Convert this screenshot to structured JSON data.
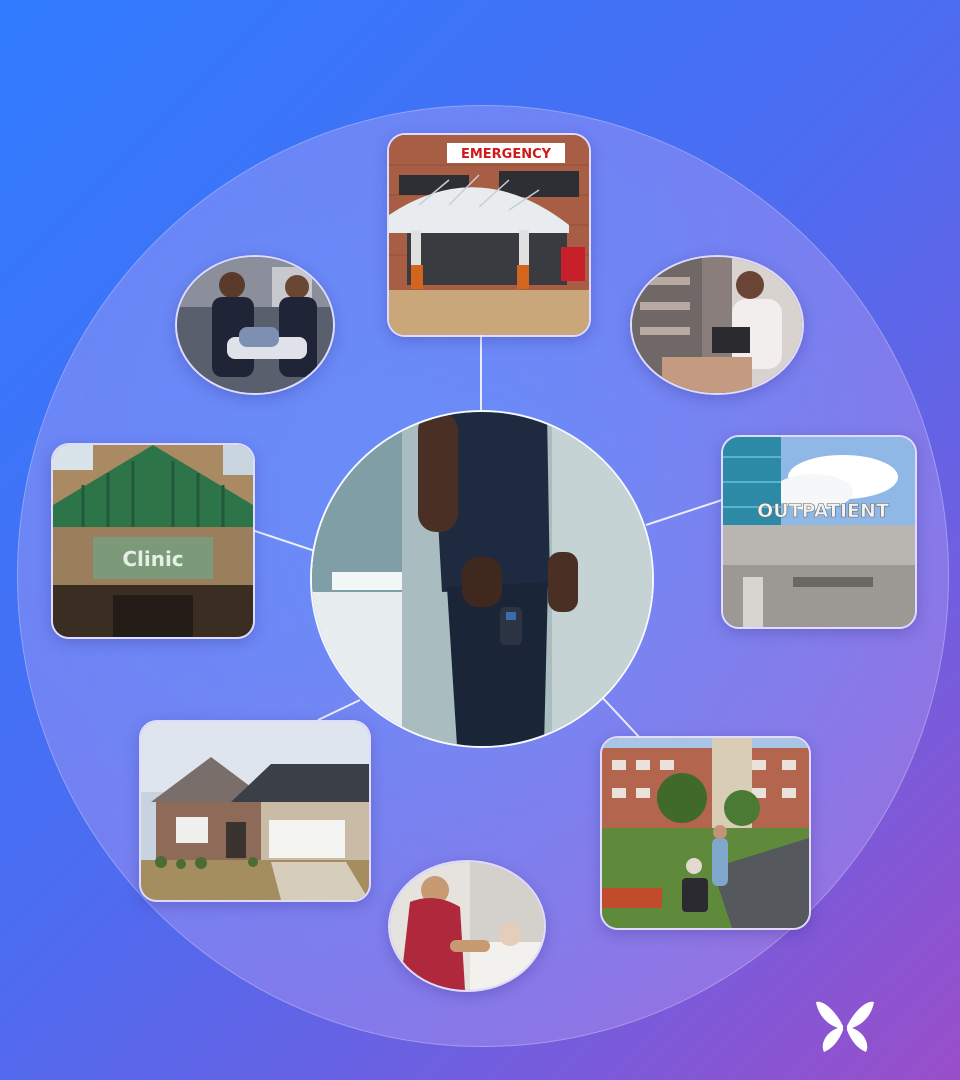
{
  "hub": {
    "name": "Care provider at center"
  },
  "settings": {
    "emergency": {
      "sign": "EMERGENCY"
    },
    "clinic": {
      "sign": "Clinic"
    },
    "outpatient": {
      "sign": "OUTPATIENT"
    }
  },
  "brand": {
    "accent": "#ffffff",
    "background_start": "#2f7bff",
    "background_end": "#9a4ec9"
  },
  "icons": [
    "butterfly-logo-icon"
  ]
}
